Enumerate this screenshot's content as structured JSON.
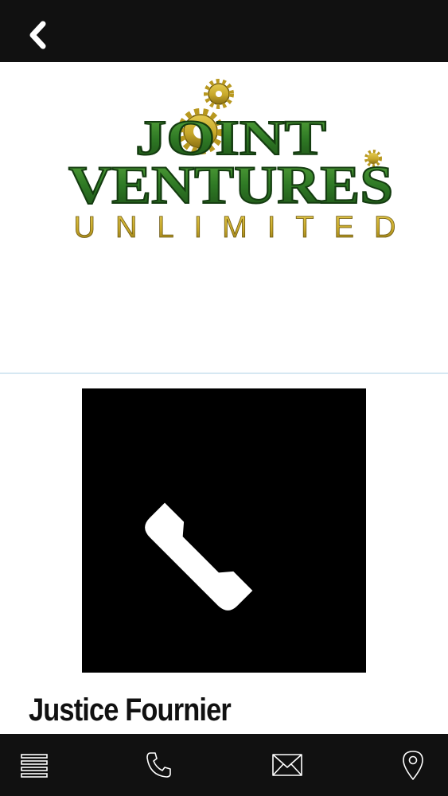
{
  "header": {
    "back_icon": "chevron-left-icon"
  },
  "logo": {
    "line1": "JOINT",
    "line2": "VENTURES",
    "line3": "UNLIMITED",
    "colors": {
      "green": "#2f7a25",
      "gold": "#c7a82a"
    }
  },
  "tile": {
    "icon": "phone-icon",
    "background": "#000000"
  },
  "contact": {
    "name": "Justice Fournier"
  },
  "bottom_nav": {
    "items": [
      {
        "icon": "menu-icon"
      },
      {
        "icon": "phone-icon"
      },
      {
        "icon": "mail-icon"
      },
      {
        "icon": "location-pin-icon"
      }
    ]
  }
}
